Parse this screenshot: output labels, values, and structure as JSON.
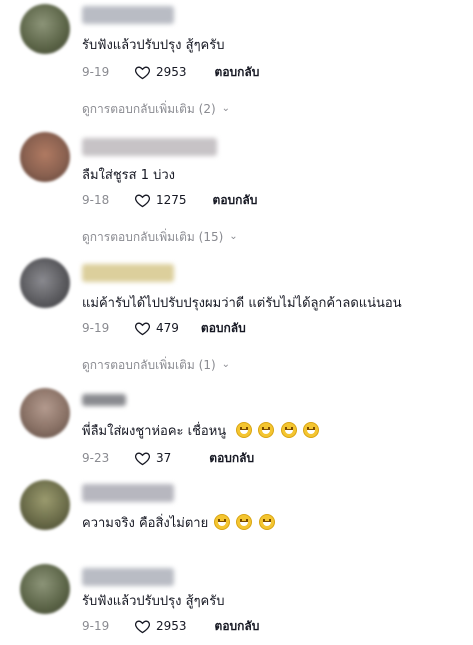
{
  "comments": [
    {
      "text": "รับฟังแล้วปรับปรุง สู้ๆครับ",
      "date": "9-19",
      "likes": "2953",
      "reply_label": "ตอบกลับ",
      "more_replies": "ดูการตอบกลับเพิ่มเติม (2)",
      "avatar_color": "#5a6346",
      "name_color": "#b9bcc4"
    },
    {
      "text": "ลืมใส่ชูรส 1 บ่วง",
      "date": "9-18",
      "likes": "1275",
      "reply_label": "ตอบกลับ",
      "more_replies": "ดูการตอบกลับเพิ่มเติม (15)",
      "avatar_color": "#8a6150",
      "name_color": "#c7c3c6"
    },
    {
      "text": "แม่ค้ารับได้ไปปรับปรุงผมว่าดี แต่รับไม่ได้ลูกค้าลดแน่นอน",
      "date": "9-19",
      "likes": "479",
      "reply_label": "ตอบกลับ",
      "more_replies": "ดูการตอบกลับเพิ่มเติม (1)",
      "avatar_color": "#5c5c60",
      "name_color": "#dccf9c"
    },
    {
      "text": "พี่ลืมใส่ผงชูาห่อคะ เชื่อหนู",
      "emoji_count": 4,
      "date": "9-23",
      "likes": "37",
      "reply_label": "ตอบกลับ",
      "avatar_color": "#8a7266",
      "name_color": "#8a8b90"
    },
    {
      "text": "ความจริง คือสิ่งไม่ตาย",
      "emoji_count": 3,
      "avatar_color": "#6c6d4a",
      "name_color": "#b7b7bf"
    },
    {
      "text": "รับฟังแล้วปรับปรุง สู้ๆครับ",
      "date": "9-19",
      "likes": "2953",
      "reply_label": "ตอบกลับ",
      "avatar_color": "#5a6346",
      "name_color": "#b9bcc4"
    }
  ],
  "icons": {
    "like": "heart-outline-icon",
    "expand": "chevron-down-icon",
    "emoji": "grinning-face-emoji"
  }
}
